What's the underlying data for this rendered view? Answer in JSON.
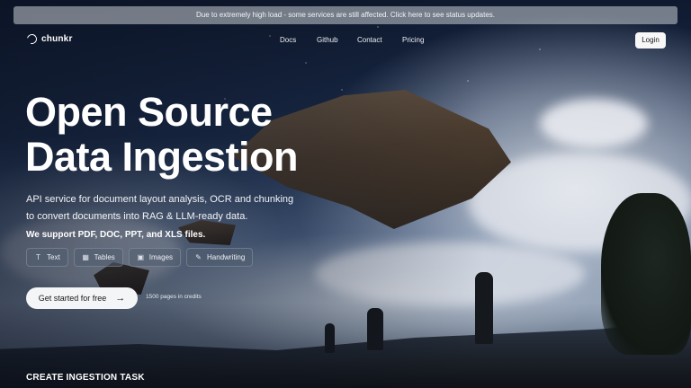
{
  "banner": {
    "text": "Due to extremely high load - some services are still affected. Click here to see status updates."
  },
  "brand": {
    "name": "chunkr",
    "icon": "chunkr-logo-icon"
  },
  "nav": {
    "links": [
      "Docs",
      "Github",
      "Contact",
      "Pricing"
    ],
    "login_label": "Login"
  },
  "hero": {
    "title_line1": "Open Source",
    "title_line2": "Data Ingestion",
    "subtitle_line1": "API service for document layout analysis, OCR and chunking",
    "subtitle_line2": "to convert documents into RAG & LLM-ready data.",
    "support_text": "We support PDF, DOC, PPT, and XLS files.",
    "chips": [
      {
        "label": "Text",
        "icon": "text-icon"
      },
      {
        "label": "Tables",
        "icon": "table-icon"
      },
      {
        "label": "Images",
        "icon": "image-icon"
      },
      {
        "label": "Handwriting",
        "icon": "pen-icon"
      }
    ],
    "cta_label": "Get started for free",
    "cta_icon": "arrow-right-icon",
    "credits_text": "1500 pages in credits"
  },
  "section": {
    "title": "CREATE INGESTION TASK"
  },
  "colors": {
    "cta_bg": "#f4f5f7",
    "cta_text": "#15181d",
    "banner_bg": "#c8cdd4"
  }
}
